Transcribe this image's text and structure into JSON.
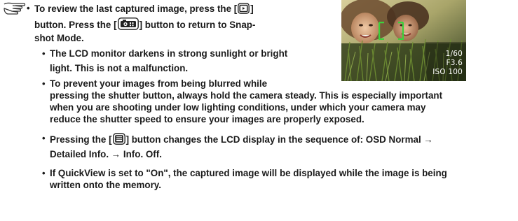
{
  "notes": {
    "b1": {
      "l1a": "To review the last captured image, press the [",
      "l1b": "]",
      "l2a": "button. Press the [",
      "l2b": "] button to return to Snap-",
      "l3": "shot Mode."
    },
    "b2": {
      "l1": "The LCD monitor darkens in strong sunlight or bright",
      "l2": "light. This is not a malfunction."
    },
    "b3": {
      "l1": "To prevent your images from being blurred while",
      "l2": "pressing the shutter button, always hold the camera steady. This is especially important",
      "l3": "when you are shooting under low lighting conditions, under which your camera may",
      "l4": "reduce the shutter speed to ensure your images are properly exposed."
    },
    "b4": {
      "l1a": "Pressing the [",
      "l1b": "] button changes the LCD display in the sequence of: OSD Normal →",
      "l2": "Detailed Info. → Info. Off."
    },
    "b5": {
      "l1": "If QuickView is set to \"On\", the captured image will be displayed while the image is being",
      "l2": "written onto the memory."
    }
  },
  "photo": {
    "shutter": "1/60",
    "aperture": "F3.6",
    "iso": "ISO 100"
  },
  "colors": {
    "focus_bracket": "#3cd23c",
    "osd_text": "#ffffff",
    "text": "#1a1a1a"
  },
  "icons": [
    "note-hand-icon",
    "playback-button-icon",
    "camera-mode-button-icon",
    "display-button-icon"
  ]
}
